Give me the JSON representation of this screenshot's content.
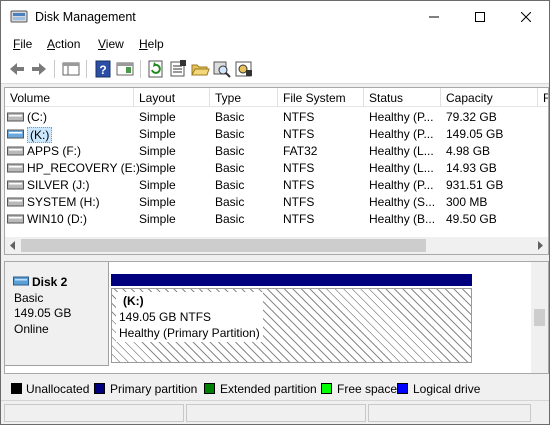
{
  "window": {
    "title": "Disk Management"
  },
  "menu": {
    "items": [
      {
        "mnemonic": "F",
        "rest": "ile"
      },
      {
        "mnemonic": "A",
        "rest": "ction"
      },
      {
        "mnemonic": "V",
        "rest": "iew"
      },
      {
        "mnemonic": "H",
        "rest": "elp"
      }
    ]
  },
  "toolbar": {
    "icons": [
      "back-arrow-icon",
      "forward-arrow-icon",
      "console-tree-icon",
      "help-icon",
      "action-pane-icon",
      "refresh-icon",
      "properties-icon",
      "open-folder-icon",
      "search-disk-icon",
      "settings-icon"
    ]
  },
  "volume_list": {
    "columns": [
      "Volume",
      "Layout",
      "Type",
      "File System",
      "Status",
      "Capacity",
      "F"
    ],
    "rows": [
      {
        "volume": "(C:)",
        "layout": "Simple",
        "type": "Basic",
        "fs": "NTFS",
        "status": "Healthy (P...",
        "capacity": "79.32 GB"
      },
      {
        "volume": "(K:)",
        "layout": "Simple",
        "type": "Basic",
        "fs": "NTFS",
        "status": "Healthy (P...",
        "capacity": "149.05 GB"
      },
      {
        "volume": "APPS (F:)",
        "layout": "Simple",
        "type": "Basic",
        "fs": "FAT32",
        "status": "Healthy (L...",
        "capacity": "4.98 GB"
      },
      {
        "volume": "HP_RECOVERY (E:)",
        "layout": "Simple",
        "type": "Basic",
        "fs": "NTFS",
        "status": "Healthy (L...",
        "capacity": "14.93 GB"
      },
      {
        "volume": "SILVER (J:)",
        "layout": "Simple",
        "type": "Basic",
        "fs": "NTFS",
        "status": "Healthy (P...",
        "capacity": "931.51 GB"
      },
      {
        "volume": "SYSTEM (H:)",
        "layout": "Simple",
        "type": "Basic",
        "fs": "NTFS",
        "status": "Healthy (S...",
        "capacity": "300 MB"
      },
      {
        "volume": "WIN10 (D:)",
        "layout": "Simple",
        "type": "Basic",
        "fs": "NTFS",
        "status": "Healthy (B...",
        "capacity": "49.50 GB"
      }
    ],
    "selected_row": 1
  },
  "disk": {
    "name": "Disk 2",
    "kind": "Basic",
    "size": "149.05 GB",
    "state": "Online",
    "partition": {
      "label": "(K:)",
      "size_fs": "149.05 GB NTFS",
      "status": "Healthy (Primary Partition)",
      "color": "#00007f"
    }
  },
  "legend": [
    {
      "label": "Unallocated",
      "color": "#000000"
    },
    {
      "label": "Primary partition",
      "color": "#00007f"
    },
    {
      "label": "Extended partition",
      "color": "#008000"
    },
    {
      "label": "Free space",
      "color": "#00ff00"
    },
    {
      "label": "Logical drive",
      "color": "#0000ff"
    }
  ]
}
